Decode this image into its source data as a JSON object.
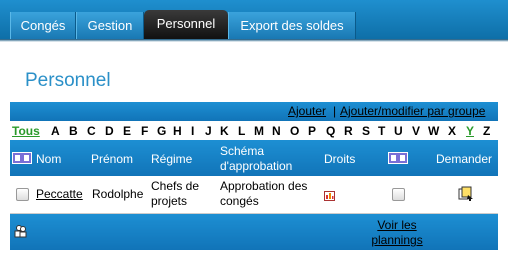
{
  "tabs": [
    {
      "label": "Congés"
    },
    {
      "label": "Gestion"
    },
    {
      "label": "Personnel"
    },
    {
      "label": "Export des soldes"
    }
  ],
  "page_title": "Personnel",
  "header_links": {
    "add": "Ajouter",
    "add_group": "Ajouter/modifier par groupe"
  },
  "letters": {
    "all": "Tous",
    "items": [
      "A",
      "B",
      "C",
      "D",
      "E",
      "F",
      "G",
      "H",
      "I",
      "J",
      "K",
      "L",
      "M",
      "N",
      "O",
      "P",
      "Q",
      "R",
      "S",
      "T",
      "U",
      "V",
      "W",
      "X",
      "Y",
      "Z"
    ],
    "selected": "Y"
  },
  "columns": {
    "nom": "Nom",
    "prenom": "Prénom",
    "regime": "Régime",
    "schema_line1": "Schéma",
    "schema_line2": "d'approbation",
    "droits": "Droits",
    "demander": "Demander"
  },
  "rows": [
    {
      "nom": "Peccatte",
      "prenom": "Rodolphe",
      "regime_line1": "Chefs de",
      "regime_line2": "projets",
      "schema_line1": "Approbation des",
      "schema_line2": "congés"
    }
  ],
  "footer": {
    "plannings_line1": "Voir les",
    "plannings_line2": "plannings"
  }
}
